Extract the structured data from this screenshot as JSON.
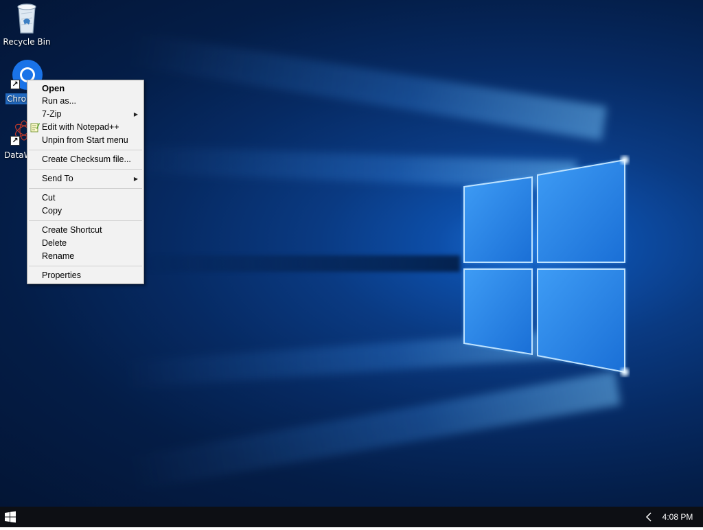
{
  "desktop": {
    "icons": [
      {
        "label": "Recycle Bin",
        "icon": "recycle-bin-icon"
      },
      {
        "label": "Chrom",
        "icon": "chrome-icon",
        "selected": true
      },
      {
        "label": "DataW",
        "icon": "datawrapper-icon"
      }
    ]
  },
  "context_menu": {
    "items": {
      "open": "Open",
      "run_as": "Run as...",
      "seven_zip": "7-Zip",
      "edit_notepad": "Edit with Notepad++",
      "unpin": "Unpin from Start menu",
      "checksum": "Create Checksum file...",
      "send_to": "Send To",
      "cut": "Cut",
      "copy": "Copy",
      "create_shortcut": "Create Shortcut",
      "delete": "Delete",
      "rename": "Rename",
      "properties": "Properties"
    }
  },
  "taskbar": {
    "clock": "4:08 PM",
    "start_icon": "windows-logo-icon",
    "tray_icon": "chevron-left-icon"
  },
  "colors": {
    "desktop_bg": "#062a63",
    "taskbar_bg": "#0d0f14",
    "menu_bg": "#f2f2f2",
    "selection": "#2878d7"
  }
}
